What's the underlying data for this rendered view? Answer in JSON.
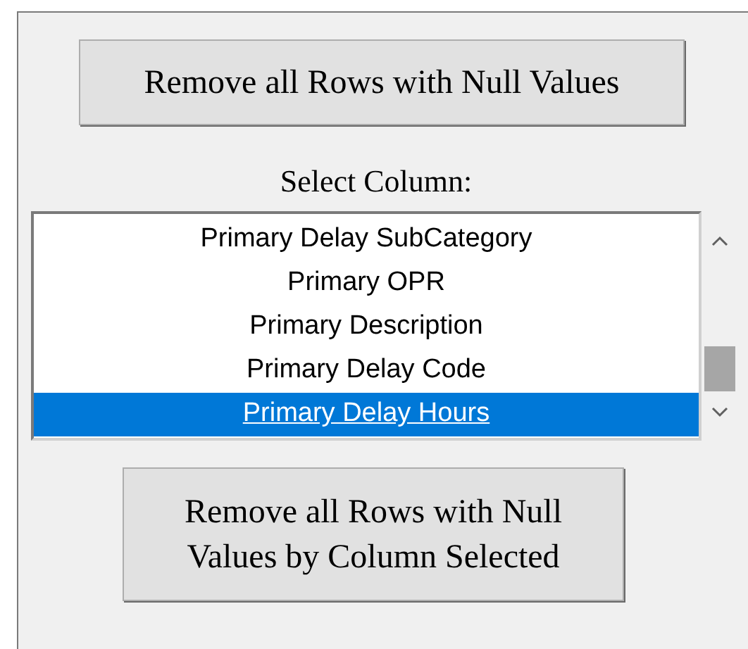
{
  "buttons": [
    {
      "label": "Remove all Rows with Null Values"
    },
    {
      "label": "Remove all Rows with Null\nValues by Column Selected"
    }
  ],
  "list_label": "Select Column:",
  "list": {
    "items": [
      {
        "label": "Primary Delay SubCategory",
        "selected": false
      },
      {
        "label": "Primary OPR",
        "selected": false
      },
      {
        "label": "Primary Description",
        "selected": false
      },
      {
        "label": "Primary Delay Code",
        "selected": false
      },
      {
        "label": "Primary Delay Hours",
        "selected": true
      }
    ]
  }
}
